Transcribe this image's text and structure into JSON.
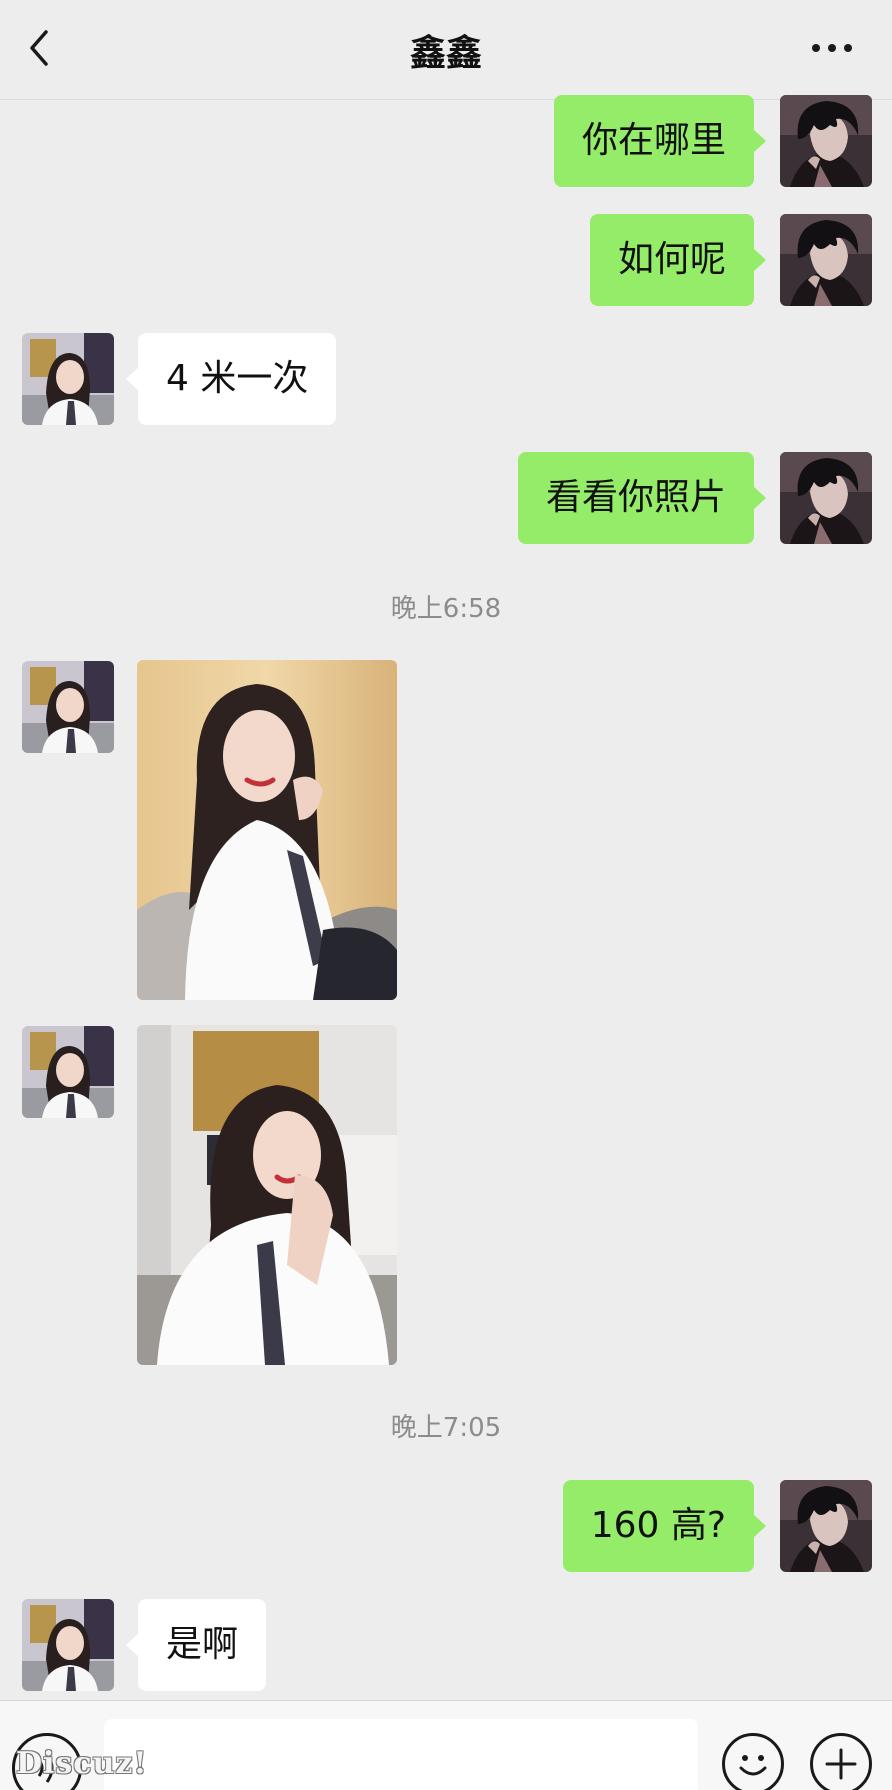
{
  "header": {
    "title": "鑫鑫",
    "back_icon": "chevron-left-icon",
    "more_icon": "more-dots-icon"
  },
  "messages": [
    {
      "direction": "out",
      "type": "text",
      "text": "你在哪里"
    },
    {
      "direction": "out",
      "type": "text",
      "text": "如何呢"
    },
    {
      "direction": "in",
      "type": "text",
      "text": "4 米一次"
    },
    {
      "direction": "out",
      "type": "text",
      "text": "看看你照片"
    },
    {
      "type": "time",
      "text": "晚上6:58"
    },
    {
      "direction": "in",
      "type": "image"
    },
    {
      "direction": "in",
      "type": "image"
    },
    {
      "type": "time",
      "text": "晚上7:05"
    },
    {
      "direction": "out",
      "type": "text",
      "text": "160 高?"
    },
    {
      "direction": "in",
      "type": "text",
      "text": "是啊"
    }
  ],
  "input_bar": {
    "voice_icon": "voice-icon",
    "input_value": "",
    "emoji_icon": "emoji-icon",
    "plus_icon": "plus-icon"
  },
  "watermark": "Discuz!",
  "colors": {
    "background": "#ededed",
    "outgoing_bubble": "#95ec69",
    "incoming_bubble": "#ffffff",
    "timestamp": "#8c8c8c"
  }
}
